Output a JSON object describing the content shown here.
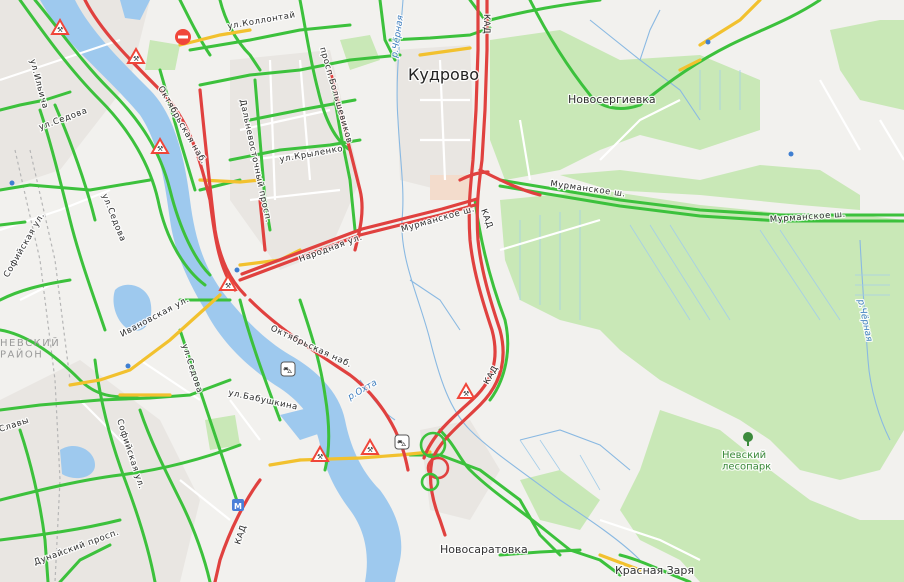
{
  "map": {
    "places": {
      "kudrovo": "Кудрово",
      "novosergievka": "Новосергиевка",
      "novosaratovka": "Новосаратовка",
      "krasnaya_zarya": "Красная Заря",
      "nevsky_park": "Невский\nлесопарк",
      "nevsky_rayon": "НЕВСКИЙ\nРАЙОН"
    },
    "streets": {
      "kollontai": "ул.Коллонтай",
      "dalnevostochny": "Дальневосточный просп.",
      "bolshevikov": "просп.Большевиков",
      "krylenko": "ул.Крыленко",
      "oktyabrskaya_n": "Октябрьская наб.",
      "oktyabrskaya_s": "Октябрьская наб.",
      "narodnaya": "Народная ул.",
      "murmanskoe_w": "Мурманское ш.",
      "murmanskoe_c": "Мурманское ш.",
      "murmanskoe_e": "Мурманское ш.",
      "kad_n": "КАД",
      "kad_m": "КАД",
      "kad_s": "КАД",
      "kad_sw": "КАД",
      "ivanovskaya": "Ивановская ул.",
      "sedova_1": "ул.Седова",
      "sedova_2": "ул.Седова",
      "sedova_3": "ул.Седова",
      "babushkina": "ул.Бабушкина",
      "sofiyskaya_1": "Софийская ул.",
      "sofiyskaya_2": "Софийская ул.",
      "dunaisky": "Дунайский просп.",
      "slavy": "Славы",
      "ilyicha": "ул.Ильича",
      "ilyicha_top": "ул.Ильича"
    },
    "water": {
      "chernaya_n": "р.Чёрная",
      "chernaya_e": "р.Чёрная",
      "okhta": "р.Охта"
    },
    "icons": {
      "roadworks": "roadwork-triangle-icon",
      "no_entry": "no-entry-icon",
      "accident": "accident-icon",
      "metro": "metro-icon",
      "tree": "park-tree-icon"
    },
    "colors": {
      "traffic_free": "#3cc13c",
      "traffic_slow": "#f2c12e",
      "traffic_jam": "#e0413f",
      "water": "#9ec9ee",
      "forest": "#c9e8b7",
      "land": "#f2f1ee",
      "roadwork": "#f0463a"
    }
  }
}
